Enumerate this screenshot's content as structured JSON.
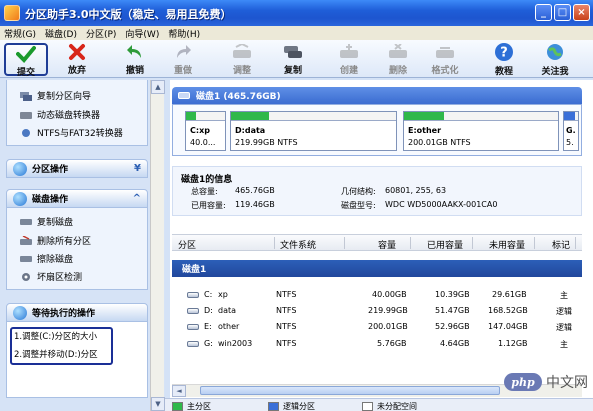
{
  "window": {
    "title": "分区助手3.0中文版（稳定、易用且免费）",
    "controls": {
      "minimize": "_",
      "maximize": "□",
      "close": "×"
    }
  },
  "menu": [
    "常规(G)",
    "磁盘(D)",
    "分区(P)",
    "向导(W)",
    "帮助(H)"
  ],
  "toolbar": {
    "submit": "提交",
    "discard": "放弃",
    "undo": "撤销",
    "redo": "重做",
    "adjust": "调整",
    "copy": "复制",
    "create": "创建",
    "delete": "删除",
    "format": "格式化",
    "tutorial": "教程",
    "follow": "关注我"
  },
  "sidebar": {
    "wizards": [
      "复制分区向导",
      "动态磁盘转换器",
      "NTFS与FAT32转换器"
    ],
    "partition_ops_title": "分区操作",
    "disk_ops_title": "磁盘操作",
    "disk_ops": [
      "复制磁盘",
      "删除所有分区",
      "擦除磁盘",
      "坏扇区检测"
    ],
    "pending_title": "等待执行的操作",
    "pending": [
      "1.调整(C:)分区的大小",
      "2.调整并移动(D:)分区"
    ]
  },
  "disk": {
    "header": "磁盘1  (465.76GB)",
    "partitions": [
      {
        "name": "C:xp",
        "size": "40.0...",
        "fill": 0.26,
        "color": "#2fb84a"
      },
      {
        "name": "D:data",
        "size": "219.99GB NTFS",
        "fill": 0.23,
        "color": "#2fb84a"
      },
      {
        "name": "E:other",
        "size": "200.01GB NTFS",
        "fill": 0.26,
        "color": "#2fb84a"
      },
      {
        "name": "G.",
        "size": "5.",
        "fill": 0.8,
        "color": "#3a6fd8"
      }
    ]
  },
  "info": {
    "title": "磁盘1的信息",
    "total_label": "总容量:",
    "total": "465.76GB",
    "used_label": "已用容量:",
    "used": "119.46GB",
    "geometry_label": "几何结构:",
    "geometry": "60801, 255, 63",
    "model_label": "磁盘型号:",
    "model": "WDC WD5000AAKX-001CA0"
  },
  "table": {
    "headers": [
      "分区",
      "文件系统",
      "容量",
      "已用容量",
      "未用容量",
      "标记"
    ],
    "disk_row": "磁盘1",
    "rows": [
      {
        "part": "C:",
        "label": "xp",
        "fs": "NTFS",
        "cap": "40.00GB",
        "used": "10.39GB",
        "free": "29.61GB",
        "flag": "主"
      },
      {
        "part": "D:",
        "label": "data",
        "fs": "NTFS",
        "cap": "219.99GB",
        "used": "51.47GB",
        "free": "168.52GB",
        "flag": "逻辑"
      },
      {
        "part": "E:",
        "label": "other",
        "fs": "NTFS",
        "cap": "200.01GB",
        "used": "52.96GB",
        "free": "147.04GB",
        "flag": "逻辑"
      },
      {
        "part": "G:",
        "label": "win2003",
        "fs": "NTFS",
        "cap": "5.76GB",
        "used": "4.64GB",
        "free": "1.12GB",
        "flag": "主"
      }
    ]
  },
  "legend": [
    {
      "label": "主分区",
      "color": "#2fb84a"
    },
    {
      "label": "逻辑分区",
      "color": "#3a6fd8"
    },
    {
      "label": "未分配空间",
      "color": "#ffffff"
    }
  ],
  "watermark": {
    "logo": "php",
    "text": "中文网"
  }
}
